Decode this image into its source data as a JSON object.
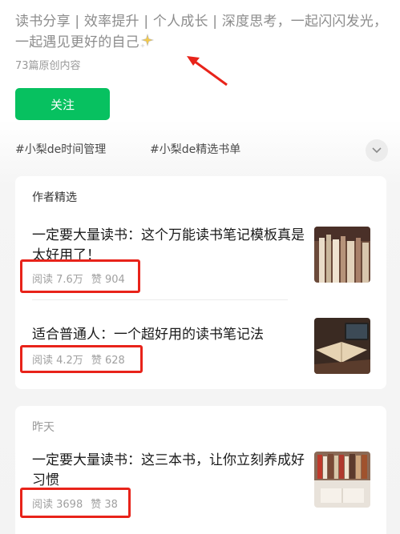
{
  "profile": {
    "bio": "读书分享 | 效率提升 | 个人成长 | 深度思考，一起闪闪发光，一起遇见更好的自己",
    "article_count": "73篇原创内容",
    "follow_label": "关注"
  },
  "tags": [
    "#小梨de时间管理",
    "#小梨de精选书单"
  ],
  "sections": [
    {
      "title": "作者精选",
      "items": [
        {
          "title": "一定要大量读书：这个万能读书笔记模板真是太好用了！",
          "reads": "阅读 7.6万",
          "likes": "赞 904"
        },
        {
          "title": "适合普通人：一个超好用的读书笔记法",
          "reads": "阅读 4.2万",
          "likes": "赞 628"
        }
      ]
    },
    {
      "title": "昨天",
      "items": [
        {
          "title": "一定要大量读书：这三本书，让你立刻养成好习惯",
          "reads": "阅读 3698",
          "likes": "赞 38"
        }
      ]
    }
  ],
  "annotation_color": "#e8231a",
  "accent_color": "#07c160"
}
